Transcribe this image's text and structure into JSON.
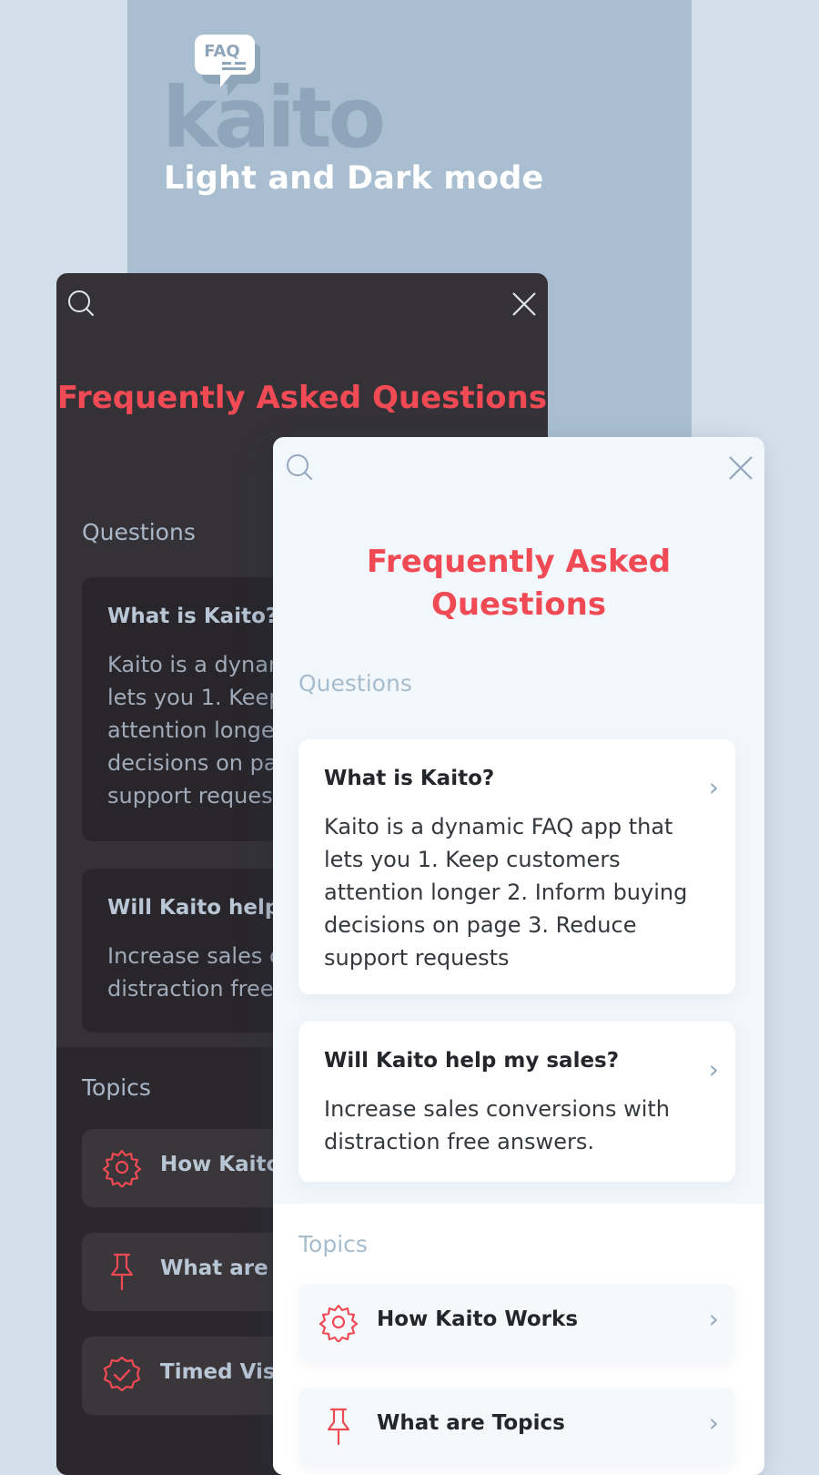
{
  "hero": {
    "logo_badge": "FAQ",
    "logo_word": "kaito",
    "title": "Light and Dark mode"
  },
  "colors": {
    "accent": "#f04a55",
    "hero_band": "#a9bfd1",
    "page_bg": "#d3dfea",
    "dark_panel": "#353237",
    "light_panel": "#f2f7fc"
  },
  "icons": {
    "search": "search-icon",
    "close": "close-icon",
    "chevron": "chevron-right-icon",
    "topic_1": "gear-icon",
    "topic_2": "pin-icon",
    "topic_3": "check-badge-icon"
  },
  "dark_panel": {
    "title": "Frequently Asked Questions",
    "questions_label": "Questions",
    "questions": [
      {
        "title": "What is Kaito?",
        "body": "Kaito is a dynamic FAQ app that lets you 1. Keep customers attention longer 2. Inform buying decisions on page 3. Reduce support requests"
      },
      {
        "title": "Will Kaito help my sales?",
        "body": "Increase sales conversions with distraction free answers."
      }
    ],
    "topics_label": "Topics",
    "topics": [
      {
        "label": "How Kaito Works"
      },
      {
        "label": "What are Topics"
      },
      {
        "label": "Timed Visibility"
      }
    ]
  },
  "light_panel": {
    "title": "Frequently Asked Questions",
    "questions_label": "Questions",
    "questions": [
      {
        "title": "What is Kaito?",
        "body": "Kaito is a dynamic FAQ app that lets you 1. Keep customers attention longer 2. Inform buying decisions on page 3. Reduce support requests"
      },
      {
        "title": "Will Kaito help my sales?",
        "body": "Increase sales conversions with distraction free answers."
      }
    ],
    "topics_label": "Topics",
    "topics": [
      {
        "label": "How Kaito Works"
      },
      {
        "label": "What are Topics"
      }
    ]
  }
}
